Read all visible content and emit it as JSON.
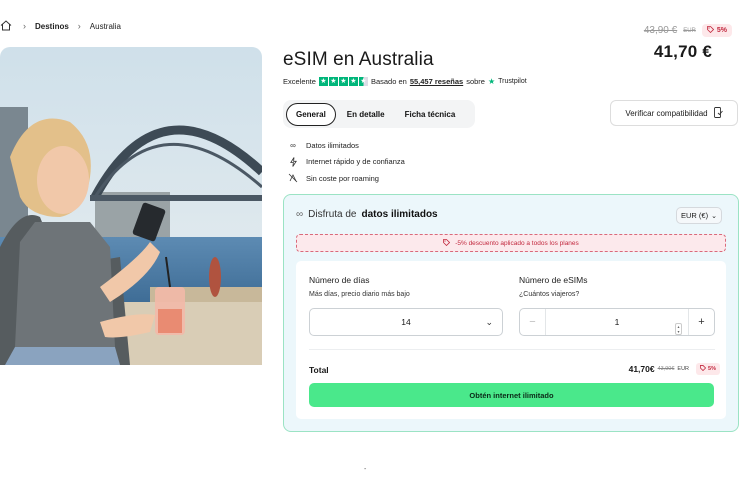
{
  "breadcrumb": {
    "items": [
      "Destinos",
      "Australia"
    ]
  },
  "price": {
    "old": "43,90 €",
    "old_currency": "EUR",
    "discount_badge": "5%",
    "current": "41,70 €"
  },
  "product": {
    "title": "eSIM en Australia",
    "rating": {
      "label": "Excelente",
      "based_on": "Basado en",
      "reviews": "55,457 reseñas",
      "on": "sobre",
      "source": "Trustpilot",
      "stars": 4.5
    }
  },
  "tabs": [
    "General",
    "En detalle",
    "Ficha técnica"
  ],
  "verify_button": "Verificar compatibilidad",
  "features": [
    {
      "icon": "infinity-icon",
      "text": "Datos ilimitados"
    },
    {
      "icon": "lightning-icon",
      "text": "Internet rápido y de confianza"
    },
    {
      "icon": "no-roaming-icon",
      "text": "Sin coste por roaming"
    }
  ],
  "plan": {
    "header_prefix": "Disfruta de",
    "header_bold": "datos ilimitados",
    "currency_select": "EUR (€)",
    "discount_notice": "-5% descuento aplicado a todos los planes",
    "days": {
      "label": "Número de días",
      "hint": "Más días, precio diario más bajo",
      "value": "14"
    },
    "esims": {
      "label": "Número de eSIMs",
      "hint": "¿Cuántos viajeros?",
      "value": "1"
    },
    "total": {
      "label": "Total",
      "price": "41,70€",
      "old": "43,90€",
      "currency": "EUR",
      "badge": "5%"
    },
    "cta": "Obtén internet ilimitado"
  },
  "footer_mark": "-",
  "colors": {
    "accent_green": "#4ae88b",
    "discount_red": "#c2283e",
    "card_border": "#9be3c4",
    "trustpilot": "#00b67a"
  }
}
